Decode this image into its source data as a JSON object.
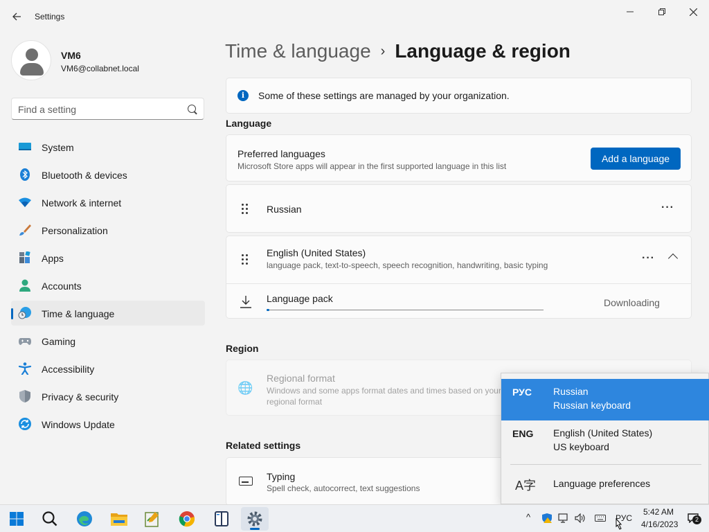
{
  "window": {
    "title": "Settings",
    "back_icon": "back-arrow-icon",
    "minimize_icon": "minimize-icon",
    "maximize_icon": "maximize-icon",
    "close_icon": "close-icon"
  },
  "user": {
    "name": "VM6",
    "email": "VM6@collabnet.local"
  },
  "search": {
    "placeholder": "Find a setting",
    "icon": "search-icon"
  },
  "sidebar": {
    "items": [
      {
        "label": "System",
        "icon": "system-icon"
      },
      {
        "label": "Bluetooth & devices",
        "icon": "bluetooth-icon"
      },
      {
        "label": "Network & internet",
        "icon": "wifi-icon"
      },
      {
        "label": "Personalization",
        "icon": "brush-icon"
      },
      {
        "label": "Apps",
        "icon": "apps-icon"
      },
      {
        "label": "Accounts",
        "icon": "accounts-icon"
      },
      {
        "label": "Time & language",
        "icon": "time-language-icon",
        "active": true
      },
      {
        "label": "Gaming",
        "icon": "gamepad-icon"
      },
      {
        "label": "Accessibility",
        "icon": "accessibility-icon"
      },
      {
        "label": "Privacy & security",
        "icon": "shield-icon"
      },
      {
        "label": "Windows Update",
        "icon": "update-icon"
      }
    ]
  },
  "header": {
    "parent": "Time & language",
    "separator": "›",
    "current": "Language & region"
  },
  "info_banner": {
    "icon": "info-icon",
    "text": "Some of these settings are managed by your organization."
  },
  "language_section": {
    "title": "Language",
    "preferred": {
      "title": "Preferred languages",
      "subtitle": "Microsoft Store apps will appear in the first supported language in this list",
      "add_button": "Add a language"
    },
    "languages": [
      {
        "name": "Russian",
        "subtitle": ""
      },
      {
        "name": "English (United States)",
        "subtitle": "language pack, text-to-speech, speech recognition, handwriting, basic typing",
        "expanded": true,
        "pack": {
          "label": "Language pack",
          "status": "Downloading",
          "progress": 0.01
        }
      }
    ],
    "more_label": "···"
  },
  "region_section": {
    "title": "Region",
    "format_title": "Regional format",
    "format_subtitle": "Windows and some apps format dates and times based on your regional format"
  },
  "related_section": {
    "title": "Related settings",
    "typing_title": "Typing",
    "typing_subtitle": "Spell check, autocorrect, text suggestions"
  },
  "flyout": {
    "items": [
      {
        "code": "РУС",
        "name": "Russian",
        "keyboard": "Russian keyboard",
        "selected": true
      },
      {
        "code": "ENG",
        "name": "English (United States)",
        "keyboard": "US keyboard",
        "selected": false
      }
    ],
    "preferences": "Language preferences",
    "preferences_icon": "language-preferences-icon"
  },
  "taskbar": {
    "apps": [
      "start-icon",
      "search-icon",
      "edge-icon",
      "file-explorer-icon",
      "notepad-icon",
      "chrome-icon",
      "reader-icon",
      "settings-icon"
    ],
    "tray": {
      "chevron": "^",
      "input_indicator": "РУС",
      "time": "5:42 AM",
      "date": "4/16/2023",
      "notification_count": "2"
    }
  },
  "colors": {
    "accent": "#0067c0",
    "flyout_selected": "#2e86de",
    "background": "#f3f3f3"
  }
}
